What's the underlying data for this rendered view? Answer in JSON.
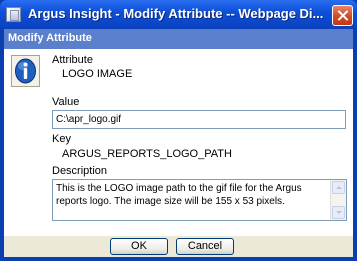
{
  "window": {
    "title": "Argus Insight - Modify Attribute -- Webpage Di...",
    "icon": "webpage-dialog-icon",
    "close_icon": "close-icon"
  },
  "dialog": {
    "header": "Modify Attribute",
    "icon": "info-icon",
    "attribute_label": "Attribute",
    "attribute_value": "LOGO IMAGE",
    "value_label": "Value",
    "value_input": "C:\\apr_logo.gif",
    "key_label": "Key",
    "key_value": "ARGUS_REPORTS_LOGO_PATH",
    "description_label": "Description",
    "description_text": "This is the LOGO image path to the gif file for the Argus reports logo. The image size will be 155 x 53 pixels."
  },
  "buttons": {
    "ok": "OK",
    "cancel": "Cancel"
  },
  "colors": {
    "titlebar": "#0a3fb2",
    "header_bar": "#5a7fcd",
    "dialog_bg": "#ece9d8",
    "close_button": "#cf4b26"
  }
}
